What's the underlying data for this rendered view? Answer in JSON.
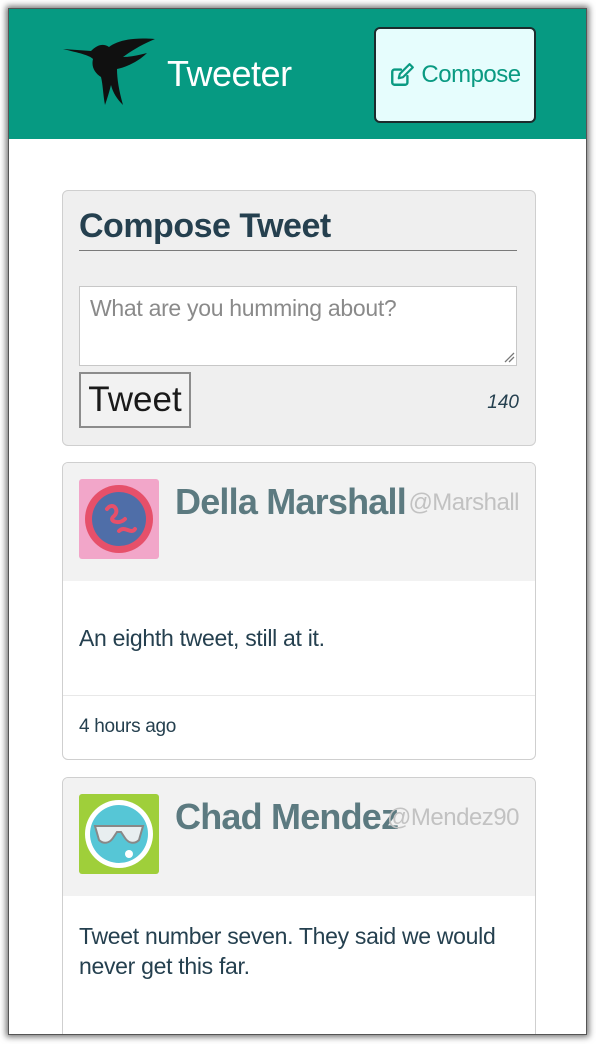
{
  "navbar": {
    "brand": "Tweeter",
    "logo_icon": "hummingbird-icon",
    "compose_label": "Compose",
    "compose_icon": "edit-icon",
    "background_color": "#069a82"
  },
  "compose": {
    "title": "Compose Tweet",
    "placeholder": "What are you humming about?",
    "value": "",
    "submit_label": "Tweet",
    "counter": "140"
  },
  "tweets": [
    {
      "name": "Della Marshall",
      "handle": "@Marshall",
      "avatar_icon": "avatar-icon",
      "text": "An eighth tweet, still at it.",
      "time": "4 hours ago"
    },
    {
      "name": "Chad Mendez",
      "handle": "@Mendez90",
      "avatar_icon": "avatar-icon",
      "text": "Tweet number seven. They said we would never get this far.",
      "time": ""
    }
  ]
}
